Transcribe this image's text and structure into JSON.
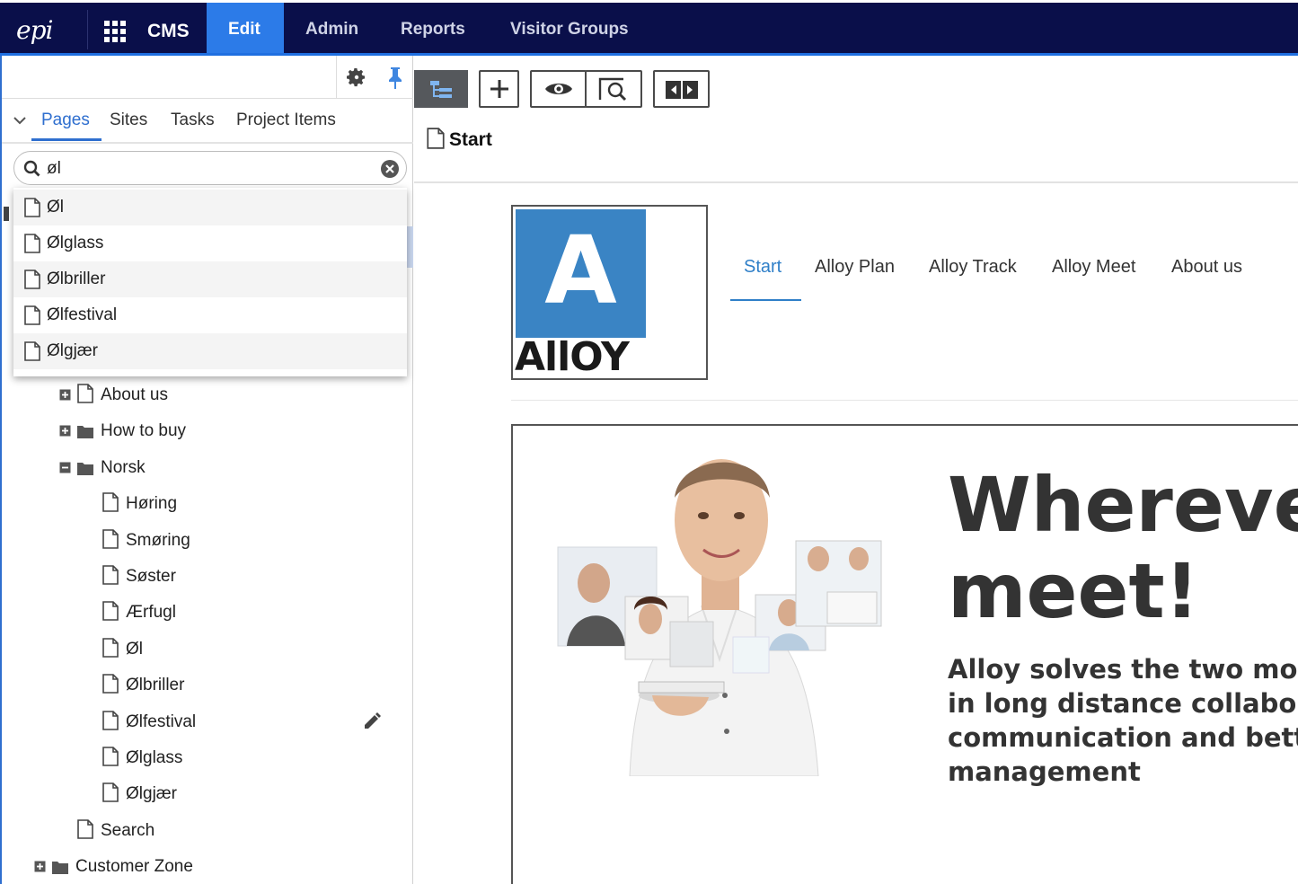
{
  "topbar": {
    "logo": "epi",
    "app": "CMS",
    "nav": [
      "Edit",
      "Admin",
      "Reports",
      "Visitor Groups"
    ],
    "active_nav": "Edit",
    "colors": {
      "bar": "#0a0f4a",
      "active": "#2c7be8"
    }
  },
  "left_pane": {
    "tabs": [
      "Pages",
      "Sites",
      "Tasks",
      "Project Items"
    ],
    "active_tab": "Pages",
    "search": {
      "value": "øl"
    },
    "suggestions": [
      "Øl",
      "Ølglass",
      "Ølbriller",
      "Ølfestival",
      "Ølgjær"
    ],
    "tree": [
      {
        "label": "About us",
        "type": "page",
        "expander": "plus"
      },
      {
        "label": "How to buy",
        "type": "folder",
        "expander": "plus"
      },
      {
        "label": "Norsk",
        "type": "folder",
        "expander": "minus"
      },
      {
        "label": "Høring",
        "type": "page"
      },
      {
        "label": "Smøring",
        "type": "page"
      },
      {
        "label": "Søster",
        "type": "page"
      },
      {
        "label": "Ærfugl",
        "type": "page"
      },
      {
        "label": "Øl",
        "type": "page"
      },
      {
        "label": "Ølbriller",
        "type": "page"
      },
      {
        "label": "Ølfestival",
        "type": "page",
        "editing": true
      },
      {
        "label": "Ølglass",
        "type": "page"
      },
      {
        "label": "Ølgjær",
        "type": "page"
      },
      {
        "label": "Search",
        "type": "page"
      },
      {
        "label": "Customer Zone",
        "type": "folder",
        "expander": "plus"
      }
    ]
  },
  "content": {
    "breadcrumb": "Start",
    "toolbar_icons": [
      "tree-toggle-icon",
      "add-icon",
      "preview-eye-icon",
      "view-search-icon",
      "compare-icon"
    ],
    "site": {
      "logo_letter": "A",
      "logo_word": "AllOY",
      "nav": [
        "Start",
        "Alloy Plan",
        "Alloy Track",
        "Alloy Meet",
        "About us"
      ],
      "active_nav": "Start",
      "hero_title_line1": "Whereve",
      "hero_title_line2": "meet!",
      "hero_sub": [
        "Alloy solves the two mo",
        "in long distance collabor",
        "communication and bett",
        "management"
      ]
    }
  }
}
